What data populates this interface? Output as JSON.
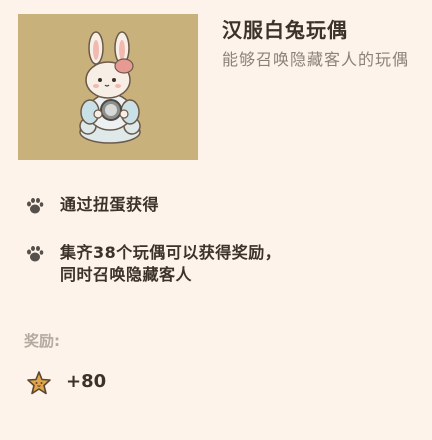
{
  "item": {
    "name": "汉服白兔玩偶",
    "description": "能够召唤隐藏客人的玩偶",
    "image_icon": "rabbit-doll-icon",
    "image_bg_color": "#c9b17c"
  },
  "info": [
    {
      "icon": "paw-icon",
      "text": "通过扭蛋获得"
    },
    {
      "icon": "paw-icon",
      "text": "集齐38个玩偶可以获得奖励，同时召唤隐藏客人"
    }
  ],
  "reward": {
    "label": "奖励:",
    "icon": "star-coin-icon",
    "amount": "+80"
  }
}
